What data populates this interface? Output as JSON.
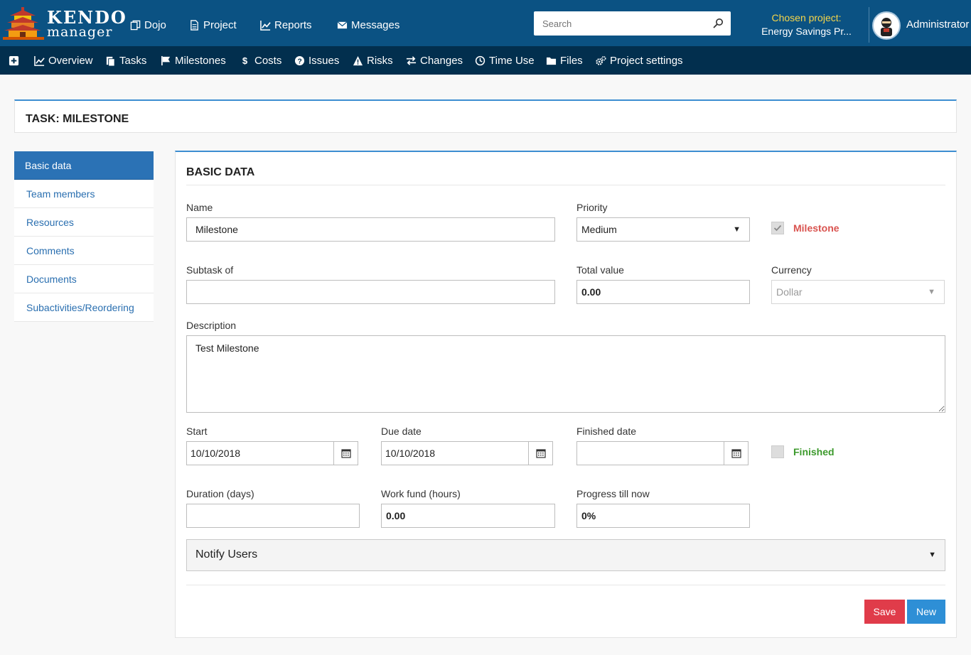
{
  "topbar": {
    "logo": {
      "line1": "KENDO",
      "line2": "manager"
    },
    "nav": [
      {
        "label": "Dojo",
        "icon": "copy-icon"
      },
      {
        "label": "Project",
        "icon": "file-icon"
      },
      {
        "label": "Reports",
        "icon": "chart-line-icon"
      },
      {
        "label": "Messages",
        "icon": "envelope-icon"
      }
    ],
    "search": {
      "placeholder": "Search",
      "value": ""
    },
    "chosen_project": {
      "label": "Chosen project:",
      "value": "Energy Savings Pr..."
    },
    "user": {
      "name": "Administrator"
    }
  },
  "subnav": [
    {
      "label": "",
      "icon": "plus-square-icon"
    },
    {
      "label": "Overview",
      "icon": "chart-line-icon"
    },
    {
      "label": "Tasks",
      "icon": "clipboard-icon"
    },
    {
      "label": "Milestones",
      "icon": "flag-icon"
    },
    {
      "label": "Costs",
      "icon": "dollar-icon"
    },
    {
      "label": "Issues",
      "icon": "question-circle-icon"
    },
    {
      "label": "Risks",
      "icon": "warning-icon"
    },
    {
      "label": "Changes",
      "icon": "exchange-icon"
    },
    {
      "label": "Time Use",
      "icon": "clock-icon"
    },
    {
      "label": "Files",
      "icon": "folder-icon"
    },
    {
      "label": "Project settings",
      "icon": "cogs-icon"
    }
  ],
  "page_title": "TASK: MILESTONE",
  "leftmenu": [
    {
      "label": "Basic data",
      "active": true
    },
    {
      "label": "Team members",
      "active": false
    },
    {
      "label": "Resources",
      "active": false
    },
    {
      "label": "Comments",
      "active": false
    },
    {
      "label": "Documents",
      "active": false
    },
    {
      "label": "Subactivities/Reordering",
      "active": false
    }
  ],
  "form": {
    "heading": "BASIC DATA",
    "name": {
      "label": "Name",
      "value": "Milestone"
    },
    "priority": {
      "label": "Priority",
      "value": "Medium"
    },
    "milestone": {
      "label": "Milestone",
      "checked": true,
      "color": "#d9534f"
    },
    "subtask_of": {
      "label": "Subtask of",
      "value": ""
    },
    "total_value": {
      "label": "Total value",
      "value": "0.00"
    },
    "currency": {
      "label": "Currency",
      "value": "Dollar"
    },
    "description": {
      "label": "Description",
      "value": "Test Milestone"
    },
    "start": {
      "label": "Start",
      "value": "10/10/2018"
    },
    "due_date": {
      "label": "Due date",
      "value": "10/10/2018"
    },
    "finished_date": {
      "label": "Finished date",
      "value": ""
    },
    "finished": {
      "label": "Finished",
      "checked": false,
      "color": "#3c9a2c"
    },
    "duration": {
      "label": "Duration (days)",
      "value": ""
    },
    "work_fund": {
      "label": "Work fund (hours)",
      "value": "0.00"
    },
    "progress": {
      "label": "Progress till now",
      "value": "0%"
    },
    "notify": {
      "label": "Notify Users"
    },
    "save_label": "Save",
    "new_label": "New"
  }
}
